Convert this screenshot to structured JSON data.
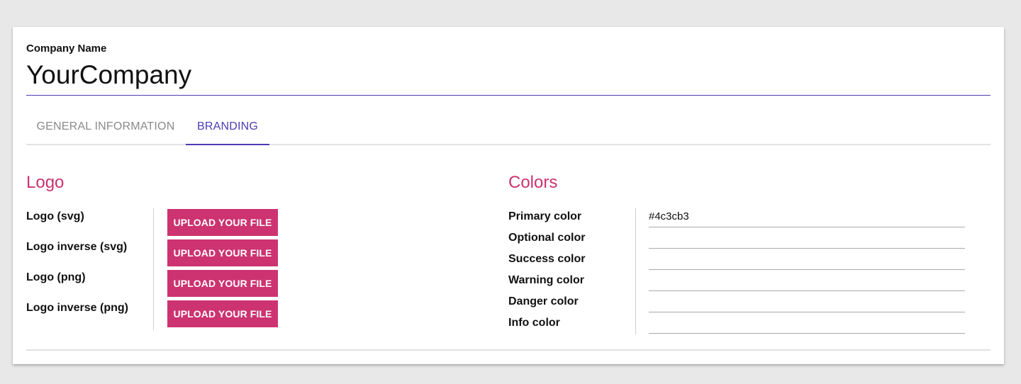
{
  "company": {
    "label": "Company Name",
    "value": "YourCompany"
  },
  "tabs": [
    {
      "label": "GENERAL INFORMATION",
      "active": false
    },
    {
      "label": "BRANDING",
      "active": true
    }
  ],
  "logo_section": {
    "title": "Logo",
    "rows": [
      {
        "label": "Logo (svg)",
        "button": "UPLOAD YOUR FILE"
      },
      {
        "label": "Logo inverse (svg)",
        "button": "UPLOAD YOUR FILE"
      },
      {
        "label": "Logo (png)",
        "button": "UPLOAD YOUR FILE"
      },
      {
        "label": "Logo inverse (png)",
        "button": "UPLOAD YOUR FILE"
      }
    ]
  },
  "colors_section": {
    "title": "Colors",
    "rows": [
      {
        "label": "Primary color",
        "value": "#4c3cb3"
      },
      {
        "label": "Optional color",
        "value": ""
      },
      {
        "label": "Success color",
        "value": ""
      },
      {
        "label": "Warning color",
        "value": ""
      },
      {
        "label": "Danger color",
        "value": ""
      },
      {
        "label": "Info color",
        "value": ""
      }
    ]
  },
  "theme": {
    "accent": "#4c3cb3",
    "brand": "#cc3370",
    "background": "#e8e8e8"
  }
}
